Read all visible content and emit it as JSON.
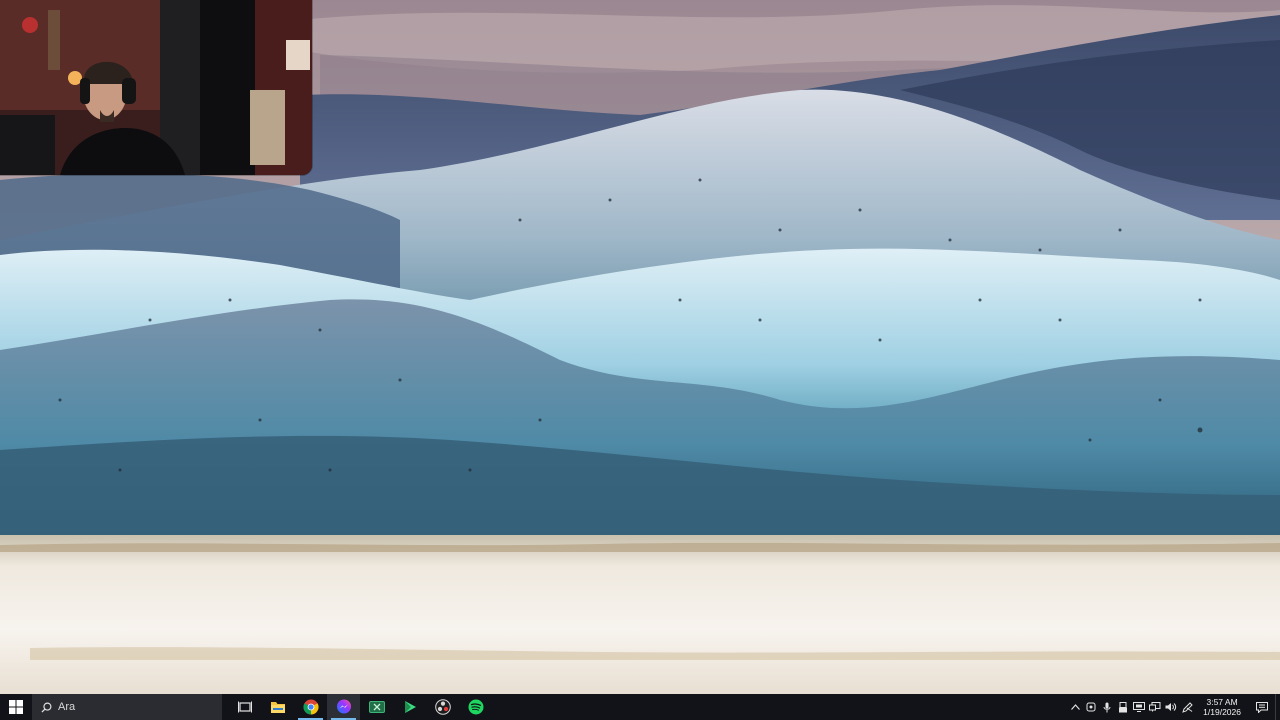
{
  "taskbar": {
    "search_placeholder": "Ara",
    "apps": [
      {
        "name": "task-view",
        "icon": "task-view-icon",
        "active": false,
        "running": false
      },
      {
        "name": "file-explorer",
        "icon": "folder-icon",
        "active": false,
        "running": false
      },
      {
        "name": "chrome",
        "icon": "chrome-icon",
        "active": false,
        "running": true
      },
      {
        "name": "messenger",
        "icon": "messenger-icon",
        "active": true,
        "running": true
      },
      {
        "name": "xbox",
        "icon": "xbox-icon",
        "active": false,
        "running": false
      },
      {
        "name": "terminal",
        "icon": "play-icon",
        "active": false,
        "running": false
      },
      {
        "name": "obs",
        "icon": "obs-icon",
        "active": false,
        "running": false
      },
      {
        "name": "spotify",
        "icon": "spotify-icon",
        "active": false,
        "running": false
      }
    ],
    "tray_icons": [
      "chevron-up-icon",
      "vpn-icon",
      "mic-icon",
      "usb-icon",
      "display-icon",
      "network-icon",
      "volume-icon",
      "pen-icon"
    ],
    "clock": {
      "time": "3:57 AM",
      "date": "1/19/2026"
    }
  },
  "colors": {
    "taskbar_bg": "#121318",
    "search_bg": "#2b2c31",
    "accent": "#76b9ed"
  }
}
